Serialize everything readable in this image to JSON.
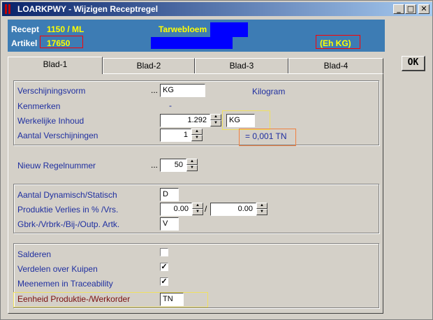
{
  "window": {
    "title": "LOARKPWY - Wijzigen Receptregel",
    "minimize": "_",
    "maximize": "□",
    "close": "✕"
  },
  "header": {
    "recept_label": "Recept",
    "recept_value": "1150 / ML",
    "recept_name": "Tarwebloem",
    "artikel_label": "Artikel",
    "artikel_value": "17650",
    "unit": "(Eh KG)"
  },
  "ok_button": "OK",
  "tabs": [
    {
      "label": "Blad-1",
      "active": true
    },
    {
      "label": "Blad-2"
    },
    {
      "label": "Blad-3"
    },
    {
      "label": "Blad-4"
    }
  ],
  "form": {
    "verschijningsvorm": {
      "label": "Verschijningsvorm",
      "dots": "...",
      "value": "KG",
      "description": "Kilogram"
    },
    "kenmerken": {
      "label": "Kenmerken",
      "value": "-"
    },
    "werkelijke_inhoud": {
      "label": "Werkelijke Inhoud",
      "value": "1.292",
      "unit": "KG"
    },
    "aantal_verschijningen": {
      "label": "Aantal Verschijningen",
      "value": "1",
      "equivalent": "= 0,001 TN"
    },
    "nieuw_regelnummer": {
      "label": "Nieuw Regelnummer",
      "dots": "...",
      "value": "50"
    },
    "aantal_dynamisch": {
      "label": "Aantal Dynamisch/Statisch",
      "value": "D"
    },
    "produktie_verlies": {
      "label": "Produktie Verlies in % /Vrs.",
      "value1": "0.00",
      "separator": "/",
      "value2": "0.00"
    },
    "gbrk": {
      "label": "Gbrk-/Vrbrk-/Bij-/Outp. Artk.",
      "value": "V"
    },
    "salderen": {
      "label": "Salderen",
      "checked": false
    },
    "verdelen": {
      "label": "Verdelen over Kuipen",
      "checked": true
    },
    "meenemen": {
      "label": "Meenemen in Traceability",
      "checked": true
    },
    "eenheid": {
      "label": "Eenheid Produktie-/Werkorder",
      "value": "TN"
    }
  },
  "colors": {
    "header_bg": "#3d7cb4",
    "header_value": "#ffff00",
    "label_blue": "#1f2fa0",
    "highlight_label": "#7a1010"
  }
}
